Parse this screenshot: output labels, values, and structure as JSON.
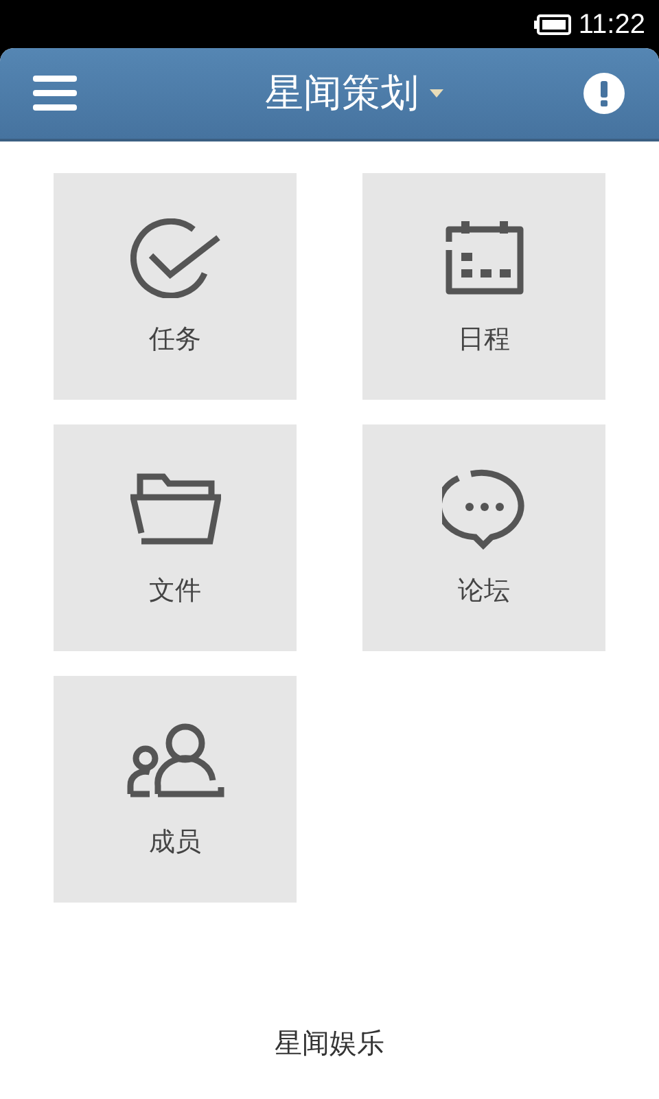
{
  "status_bar": {
    "time": "11:22"
  },
  "header": {
    "title": "星闻策划"
  },
  "tiles": [
    {
      "kind": "task",
      "label": "任务"
    },
    {
      "kind": "calendar",
      "label": "日程"
    },
    {
      "kind": "file",
      "label": "文件"
    },
    {
      "kind": "forum",
      "label": "论坛"
    },
    {
      "kind": "members",
      "label": "成员"
    }
  ],
  "footer": {
    "text": "星闻娱乐"
  }
}
